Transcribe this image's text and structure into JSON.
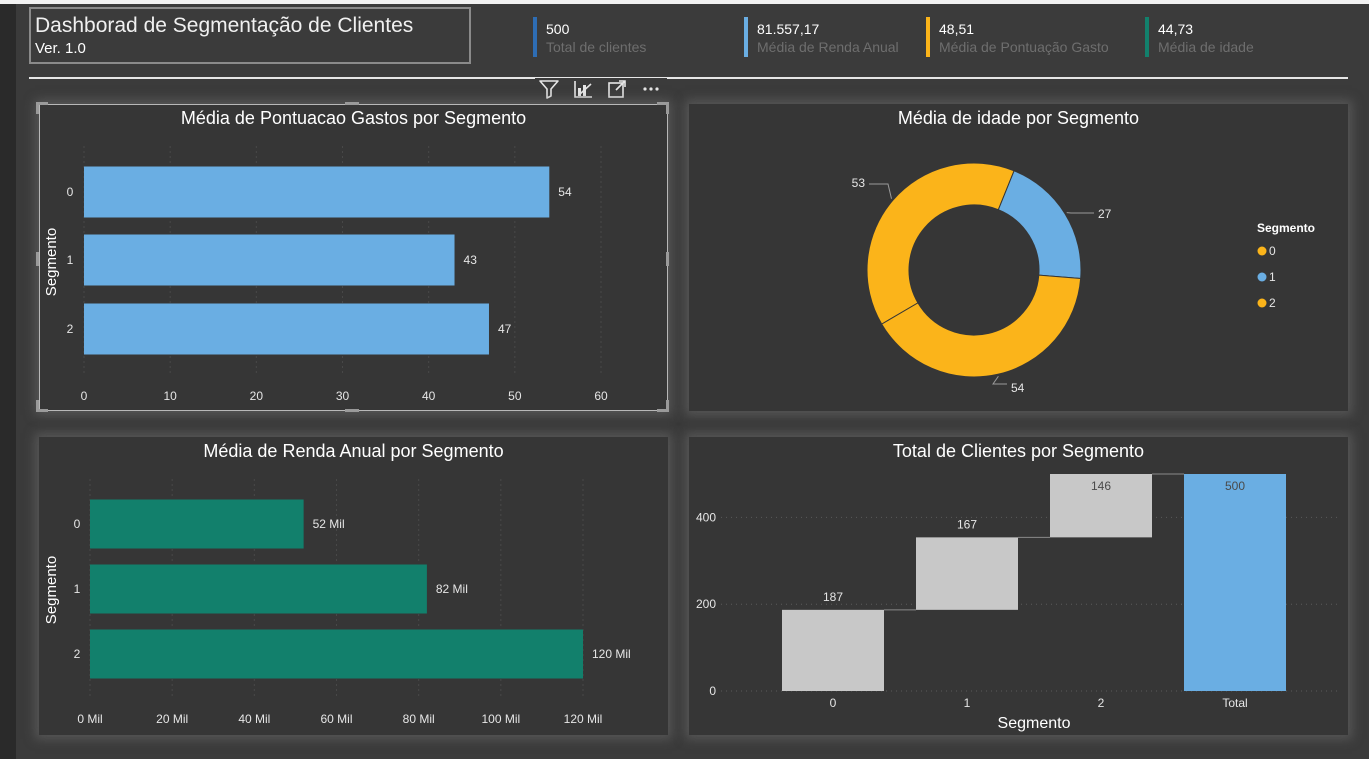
{
  "header": {
    "title": "Dashborad de Segmentação de Clientes",
    "version": "Ver. 1.0"
  },
  "kpis": [
    {
      "value": "500",
      "label": "Total de clientes",
      "color": "#2e6db4"
    },
    {
      "value": "81.557,17",
      "label": "Média de Renda Anual",
      "color": "#6aaee3"
    },
    {
      "value": "48,51",
      "label": "Média de Pontuação Gasto",
      "color": "#fbb41a"
    },
    {
      "value": "44,73",
      "label": "Média de idade",
      "color": "#12806c"
    }
  ],
  "toolbar": {
    "icons": [
      "filter-icon",
      "focus-chart-icon",
      "expand-icon",
      "more-options-icon"
    ]
  },
  "colors": {
    "blue": "#6aaee3",
    "yellow": "#fbb41a",
    "teal": "#12806c",
    "gray": "#c8c8c8"
  },
  "chart_data": [
    {
      "type": "bar",
      "title": "Média de Pontuacao Gastos por Segmento",
      "ylabel": "Segmento",
      "xlabel": "",
      "categories": [
        "0",
        "1",
        "2"
      ],
      "values": [
        54,
        43,
        47
      ],
      "data_labels": [
        "54",
        "43",
        "47"
      ],
      "xlim": [
        0,
        60
      ],
      "xticks": [
        0,
        10,
        20,
        30,
        40,
        50,
        60
      ],
      "xtick_labels": [
        "0",
        "10",
        "20",
        "30",
        "40",
        "50",
        "60"
      ],
      "orientation": "horizontal",
      "color": "#6aaee3",
      "grid": true
    },
    {
      "type": "pie",
      "title": "Média de idade por Segmento",
      "labels": [
        "0",
        "1",
        "2"
      ],
      "values": [
        53,
        27,
        54
      ],
      "data_labels": [
        "53",
        "27",
        "54"
      ],
      "colors": [
        "#fbb41a",
        "#6aaee3",
        "#fbb41a"
      ],
      "legend_title": "Segmento",
      "legend_position": "right",
      "donut": true
    },
    {
      "type": "bar",
      "title": "Média de Renda Anual por Segmento",
      "ylabel": "Segmento",
      "xlabel": "",
      "categories": [
        "0",
        "1",
        "2"
      ],
      "values": [
        52000,
        82000,
        120000
      ],
      "data_labels": [
        "52 Mil",
        "82 Mil",
        "120 Mil"
      ],
      "xlim": [
        0,
        120000
      ],
      "xticks": [
        0,
        20000,
        40000,
        60000,
        80000,
        100000,
        120000
      ],
      "xtick_labels": [
        "0 Mil",
        "20 Mil",
        "40 Mil",
        "60 Mil",
        "80 Mil",
        "100 Mil",
        "120 Mil"
      ],
      "orientation": "horizontal",
      "color": "#12806c",
      "grid": true
    },
    {
      "type": "bar",
      "title": "Total de Clientes por Segmento",
      "subtype": "waterfall",
      "xlabel": "Segmento",
      "ylabel": "",
      "categories": [
        "0",
        "1",
        "2",
        "Total"
      ],
      "values": [
        187,
        167,
        146,
        500
      ],
      "data_labels": [
        "187",
        "167",
        "146",
        "500"
      ],
      "ylim": [
        0,
        500
      ],
      "yticks": [
        0,
        200,
        400
      ],
      "ytick_labels": [
        "0",
        "200",
        "400"
      ],
      "colors": [
        "#c8c8c8",
        "#c8c8c8",
        "#c8c8c8",
        "#6aaee3"
      ],
      "grid": true
    }
  ]
}
